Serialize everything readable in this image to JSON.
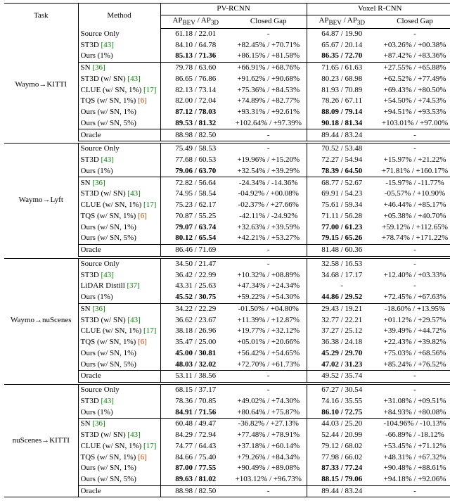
{
  "header": {
    "task": "Task",
    "method": "Method",
    "pv": "PV-RCNN",
    "voxel": "Voxel R-CNN",
    "metric": "APBEV / AP3D",
    "gap": "Closed Gap",
    "bev": "BEV",
    "d3": "3D"
  },
  "tasks": [
    "Waymo→KITTI",
    "Waymo→Lyft",
    "Waymo→nuScenes",
    "nuScenes→KITTI"
  ],
  "blocks": [
    {
      "task_idx": 0,
      "groups": [
        [
          {
            "m": "Source Only",
            "pv": "61.18 / 22.01",
            "pvg": "-",
            "vx": "64.87 / 19.90",
            "vxg": "-"
          },
          {
            "m": "ST3D",
            "ref": "[43]",
            "refcls": "ref",
            "pv": "84.10 / 64.78",
            "pvg": "+82.45% / +70.71%",
            "vx": "65.67 / 20.14",
            "vxg": "+03.26% / +00.38%"
          },
          {
            "m": "Ours (1%)",
            "bold": true,
            "pv": "85.13 / 71.36",
            "pvg": "+86.15% / +81.58%",
            "vx": "86.35 / 72.70",
            "vxg": "+87.42% / +83.36%"
          }
        ],
        [
          {
            "m": "SN",
            "ref": "[36]",
            "refcls": "ref",
            "pv": "79.78 / 63.60",
            "pvg": "+66.91% / +68.76%",
            "vx": "71.65 / 61.63",
            "vxg": "+27.55% / +65.88%"
          },
          {
            "m": "ST3D (w/ SN)",
            "ref": "[43]",
            "refcls": "ref",
            "pv": "86.65 / 76.86",
            "pvg": "+91.62% / +90.68%",
            "vx": "80.23 / 68.98",
            "vxg": "+62.52% / +77.49%"
          },
          {
            "m": "CLUE (w/ SN, 1%)",
            "ref": "[17]",
            "refcls": "ref",
            "pv": "82.13 / 73.14",
            "pvg": "+75.36% / +84.53%",
            "vx": "81.93 / 70.89",
            "vxg": "+69.43% / +80.50%"
          },
          {
            "m": "TQS (w/ SN, 1%)",
            "ref": "[6]",
            "refcls": "reforange",
            "pv": "82.00 / 72.04",
            "pvg": "+74.89% / +82.77%",
            "vx": "78.26 / 67.11",
            "vxg": "+54.50% / +74.53%"
          },
          {
            "m": "Ours (w/ SN, 1%)",
            "bold": true,
            "pv": "87.12 / 78.03",
            "pvg": "+93.31% / +92.61%",
            "vx": "88.09 / 79.14",
            "vxg": "+94.51% / +93.53%"
          },
          {
            "m": "Ours (w/ SN, 5%)",
            "bold": true,
            "pv": "89.53 / 81.32",
            "pvg": "+102.64% / +97.39%",
            "vx": "90.18 / 81.34",
            "vxg": "+103.01% / +97.00%"
          }
        ],
        [
          {
            "m": "Oracle",
            "pv": "88.98 / 82.50",
            "pvg": "-",
            "vx": "89.44 / 83.24",
            "vxg": "-"
          }
        ]
      ]
    },
    {
      "task_idx": 1,
      "groups": [
        [
          {
            "m": "Source Only",
            "pv": "75.49 / 58.53",
            "pvg": "-",
            "vx": "70.52 / 53.48",
            "vxg": "-"
          },
          {
            "m": "ST3D",
            "ref": "[43]",
            "refcls": "ref",
            "pv": "77.68 / 60.53",
            "pvg": "+19.96% / +15.20%",
            "vx": "72.27 / 54.94",
            "vxg": "+15.97% / +21.22%"
          },
          {
            "m": "Ours (1%)",
            "bold": true,
            "pv": "79.06 / 63.70",
            "pvg": "+32.54% / +39.29%",
            "vx": "78.39 / 64.50",
            "vxg": "+71.81% / +160.17%"
          }
        ],
        [
          {
            "m": "SN",
            "ref": "[36]",
            "refcls": "ref",
            "pv": "72.82 / 56.64",
            "pvg": "-24.34% / -14.36%",
            "vx": "68.77 / 52.67",
            "vxg": "-15.97% / -11.77%"
          },
          {
            "m": "ST3D (w/ SN)",
            "ref": "[43]",
            "refcls": "ref",
            "pv": "74.95 / 58.54",
            "pvg": "-04.92% / +00.08%",
            "vx": "69.91 / 54.23",
            "vxg": "-05.57% / +10.90%"
          },
          {
            "m": "CLUE (w/ SN, 1%)",
            "ref": "[17]",
            "refcls": "ref",
            "pv": "75.23 / 62.17",
            "pvg": "-02.37% / +27.66%",
            "vx": "75.61 / 59.34",
            "vxg": "+46.44% / +85.17%"
          },
          {
            "m": "TQS (w/ SN, 1%)",
            "ref": "[6]",
            "refcls": "reforange",
            "pv": "70.87 / 55.25",
            "pvg": "-42.11% / -24.92%",
            "vx": "71.11 / 56.28",
            "vxg": "+05.38% / +40.70%"
          },
          {
            "m": "Ours (w/ SN, 1%)",
            "bold": true,
            "pv": "79.07 / 63.74",
            "pvg": "+32.63% / +39.59%",
            "vx": "77.00 / 61.23",
            "vxg": "+59.12% / +112.65%"
          },
          {
            "m": "Ours (w/ SN, 5%)",
            "bold": true,
            "pv": "80.12 / 65.54",
            "pvg": "+42.21% / +53.27%",
            "vx": "79.15 / 65.26",
            "vxg": "+78.74% / +171.22%"
          }
        ],
        [
          {
            "m": "Oracle",
            "pv": "86.46 / 71.69",
            "pvg": "-",
            "vx": "81.48 / 60.36",
            "vxg": "-"
          }
        ]
      ]
    },
    {
      "task_idx": 2,
      "groups": [
        [
          {
            "m": "Source Only",
            "pv": "34.50 / 21.47",
            "pvg": "-",
            "vx": "32.58 / 16.53",
            "vxg": "-"
          },
          {
            "m": "ST3D",
            "ref": "[43]",
            "refcls": "ref",
            "pv": "36.42 / 22.99",
            "pvg": "+10.32% / +08.89%",
            "vx": "34.68 / 17.17",
            "vxg": "+12.40% / +03.33%"
          },
          {
            "m": "LiDAR Distill",
            "ref": "[37]",
            "refcls": "ref",
            "pv": "43.31 / 25.63",
            "pvg": "+47.34% / +24.34%",
            "vx": "-",
            "vxg": "-"
          },
          {
            "m": "Ours (1%)",
            "bold": true,
            "pv": "45.52 / 30.75",
            "pvg": "+59.22% / +54.30%",
            "vx": "44.86 / 29.52",
            "vxg": "+72.45% / +67.63%"
          }
        ],
        [
          {
            "m": "SN",
            "ref": "[36]",
            "refcls": "ref",
            "pv": "34.22 / 22.29",
            "pvg": "-01.50% / +04.80%",
            "vx": "29.43 / 19.21",
            "vxg": "-18.60% / +13.95%"
          },
          {
            "m": "ST3D (w/ SN)",
            "ref": "[43]",
            "refcls": "ref",
            "pv": "36.62 / 23.67",
            "pvg": "+11.39% / +12.87%",
            "vx": "32.77 / 22.21",
            "vxg": "+01.12% / +29.57%"
          },
          {
            "m": "CLUE (w/ SN, 1%)",
            "ref": "[17]",
            "refcls": "ref",
            "pv": "38.18 / 26.96",
            "pvg": "+19.77% / +32.12%",
            "vx": "37.27 / 25.12",
            "vxg": "+39.49% / +44.72%"
          },
          {
            "m": "TQS (w/ SN, 1%)",
            "ref": "[6]",
            "refcls": "reforange",
            "pv": "35.47 / 25.00",
            "pvg": "+05.01% / +20.66%",
            "vx": "36.38 / 24.18",
            "vxg": "+22.43% / +39.82%"
          },
          {
            "m": "Ours (w/ SN, 1%)",
            "bold": true,
            "pv": "45.00 / 30.81",
            "pvg": "+56.42% / +54.65%",
            "vx": "45.29 / 29.70",
            "vxg": "+75.03% / +68.56%"
          },
          {
            "m": "Ours (w/ SN, 5%)",
            "bold": true,
            "pv": "48.03 / 32.02",
            "pvg": "+72.70% / +61.73%",
            "vx": "47.02 / 31.23",
            "vxg": "+85.24% / +76.52%"
          }
        ],
        [
          {
            "m": "Oracle",
            "pv": "53.11 / 38.56",
            "pvg": "-",
            "vx": "49.52 / 35.74",
            "vxg": "-"
          }
        ]
      ]
    },
    {
      "task_idx": 3,
      "groups": [
        [
          {
            "m": "Source Only",
            "pv": "68.15 / 37.17",
            "pvg": "-",
            "vx": "67.27 / 30.54",
            "vxg": "-"
          },
          {
            "m": "ST3D",
            "ref": "[43]",
            "refcls": "ref",
            "pv": "78.36 / 70.85",
            "pvg": "+49.02% / +74.30%",
            "vx": "74.16 / 35.55",
            "vxg": "+31.08% / +09.51%"
          },
          {
            "m": "Ours (1%)",
            "bold": true,
            "pv": "84.91 / 71.56",
            "pvg": "+80.64% / +75.87%",
            "vx": "86.10 / 72.75",
            "vxg": "+84.93% / +80.08%"
          }
        ],
        [
          {
            "m": "SN",
            "ref": "[36]",
            "refcls": "ref",
            "pv": "60.48 / 49.47",
            "pvg": "-36.82% / +27.13%",
            "vx": "44.03 / 25.20",
            "vxg": "-104.96% / -10.13%"
          },
          {
            "m": "ST3D (w/ SN)",
            "ref": "[43]",
            "refcls": "ref",
            "pv": "84.29 / 72.94",
            "pvg": "+77.48% / +78.91%",
            "vx": "52.44 / 20.99",
            "vxg": "-66.89% / -18.12%"
          },
          {
            "m": "CLUE (w/ SN, 1%)",
            "ref": "[17]",
            "refcls": "ref",
            "pv": "74.77 / 64.43",
            "pvg": "+37.18% / +60.14%",
            "vx": "79.12 / 68.02",
            "vxg": "+53.45% / +71.12%"
          },
          {
            "m": "TQS (w/ SN, 1%)",
            "ref": "[6]",
            "refcls": "reforange",
            "pv": "84.66 / 75.40",
            "pvg": "+79.26% / +84.34%",
            "vx": "77.98 / 66.02",
            "vxg": "+48.31% / +67.32%"
          },
          {
            "m": "Ours (w/ SN, 1%)",
            "bold": true,
            "pv": "87.00 / 77.55",
            "pvg": "+90.49% / +89.08%",
            "vx": "87.33 / 77.24",
            "vxg": "+90.48% / +88.61%"
          },
          {
            "m": "Ours (w/ SN, 5%)",
            "bold": true,
            "pv": "89.63 / 81.02",
            "pvg": "+103.12% / +96.73%",
            "vx": "88.15 / 79.06",
            "vxg": "+94.18% / +92.06%"
          }
        ],
        [
          {
            "m": "Oracle",
            "pv": "88.98 / 82.50",
            "pvg": "-",
            "vx": "89.44 / 83.24",
            "vxg": "-"
          }
        ]
      ]
    }
  ]
}
